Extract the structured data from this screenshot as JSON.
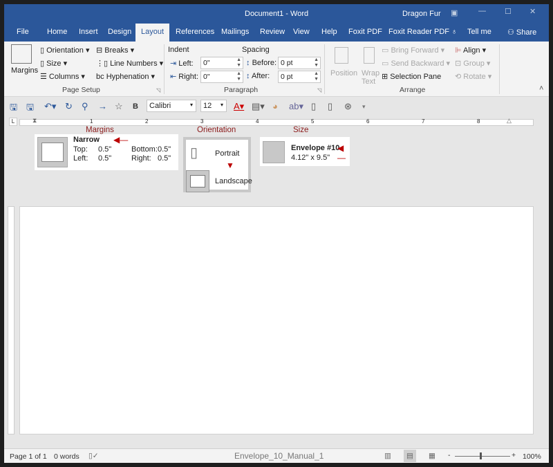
{
  "window": {
    "title": "Document1 - Word",
    "user": "Dragon Fur"
  },
  "tabs": [
    "File",
    "Home",
    "Insert",
    "Design",
    "Layout",
    "References",
    "Mailings",
    "Review",
    "View",
    "Help",
    "Foxit PDF",
    "Foxit Reader PDF",
    "Tell me",
    "Share"
  ],
  "ribbon": {
    "page_setup": {
      "margins": "Margins",
      "orientation": "Orientation",
      "size": "Size",
      "columns": "Columns",
      "breaks": "Breaks",
      "line_numbers": "Line Numbers",
      "hyphenation": "Hyphenation",
      "label": "Page Setup"
    },
    "paragraph": {
      "indent": "Indent",
      "spacing": "Spacing",
      "left": "Left:",
      "right": "Right:",
      "before": "Before:",
      "after": "After:",
      "left_val": "0\"",
      "right_val": "0\"",
      "before_val": "0 pt",
      "after_val": "0 pt",
      "label": "Paragraph"
    },
    "arrange": {
      "position": "Position",
      "wrap": "Wrap",
      "text": "Text",
      "bring_forward": "Bring Forward",
      "send_backward": "Send Backward",
      "selection_pane": "Selection Pane",
      "align": "Align",
      "group": "Group",
      "rotate": "Rotate",
      "label": "Arrange"
    }
  },
  "qat": {
    "font": "Calibri",
    "size": "12",
    "bold": "B"
  },
  "annotations": {
    "margins": {
      "heading": "Margins",
      "name": "Narrow",
      "top_l": "Top:",
      "top_v": "0.5\"",
      "bottom_l": "Bottom:",
      "bottom_v": "0.5\"",
      "left_l": "Left:",
      "left_v": "0.5\"",
      "right_l": "Right:",
      "right_v": "0.5\""
    },
    "orientation": {
      "heading": "Orientation",
      "portrait": "Portrait",
      "landscape": "Landscape"
    },
    "size": {
      "heading": "Size",
      "name": "Envelope #10",
      "dims": "4.12\" x 9.5\""
    }
  },
  "ruler": [
    "1",
    "2",
    "3",
    "4",
    "5",
    "6",
    "7",
    "8"
  ],
  "status": {
    "page": "Page 1 of 1",
    "words": "0 words",
    "doc": "Envelope_10_Manual_1",
    "zoom": "100%",
    "zoom_minus": "-",
    "zoom_plus": "+"
  },
  "colors": {
    "accent": "#2b579a",
    "annotation": "#8b1a1a"
  }
}
